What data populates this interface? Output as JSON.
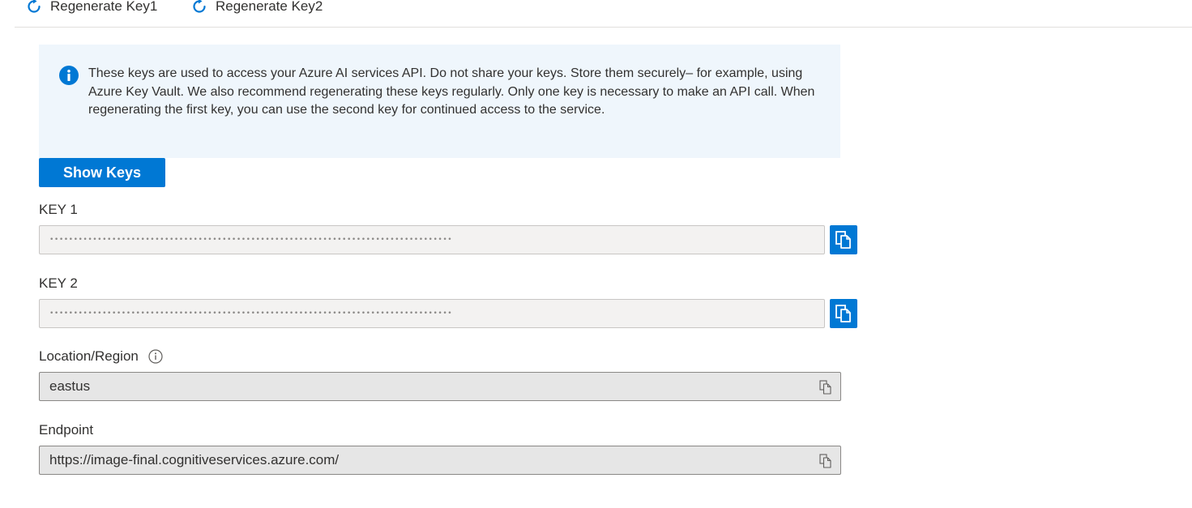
{
  "toolbar": {
    "regenerate_key1_label": "Regenerate Key1",
    "regenerate_key2_label": "Regenerate Key2",
    "icon": "refresh-icon"
  },
  "info_banner": {
    "icon": "info-icon",
    "text": "These keys are used to access your Azure AI services API. Do not share your keys. Store them securely– for example, using Azure Key Vault. We also recommend regenerating these keys regularly. Only one key is necessary to make an API call. When regenerating the first key, you can use the second key for continued access to the service."
  },
  "show_keys_label": "Show Keys",
  "key1": {
    "label": "KEY 1",
    "masked_value": "••••••••••••••••••••••••••••••••••••••••••••••••••••••••••••••••••••••••••••••••••••"
  },
  "key2": {
    "label": "KEY 2",
    "masked_value": "••••••••••••••••••••••••••••••••••••••••••••••••••••••••••••••••••••••••••••••••••••"
  },
  "location": {
    "label": "Location/Region",
    "value": "eastus"
  },
  "endpoint": {
    "label": "Endpoint",
    "value": "https://image-final.cognitiveservices.azure.com/"
  },
  "colors": {
    "accent": "#0078d4",
    "banner_bg": "#eff6fc",
    "readonly_bg": "#e6e6e6",
    "key_bg": "#f3f2f1"
  }
}
